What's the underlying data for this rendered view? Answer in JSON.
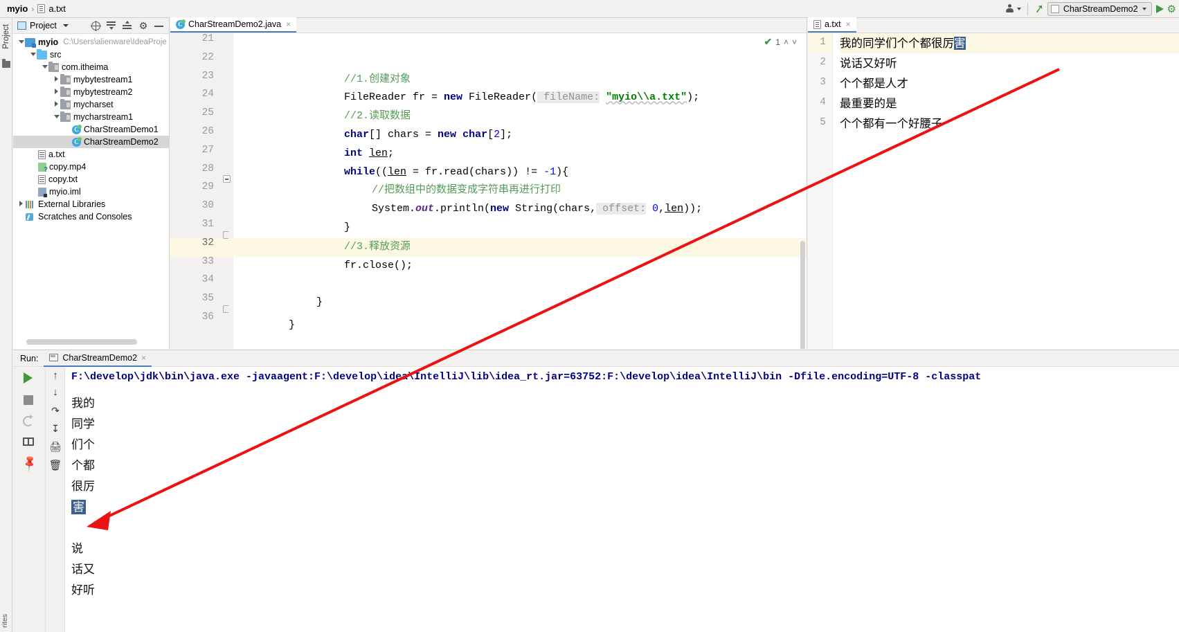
{
  "window": {
    "breadcrumb_root": "myio",
    "breadcrumb_sep": "›",
    "breadcrumb_file": "a.txt"
  },
  "toolbar": {
    "person_icon": "person-icon",
    "caret_icon": "chevron-down-icon",
    "hammer_icon": "hammer-icon",
    "run_config_name": "CharStreamDemo2",
    "run_config_caret": "∨",
    "run_button": "run-icon",
    "debug_button": "debug-icon"
  },
  "left_strip": {
    "project_tab": "Project",
    "favorites_tab": "rites"
  },
  "project_panel": {
    "title": "Project",
    "title_caret": "▾",
    "icons": [
      "locate-icon",
      "expand-all-icon",
      "collapse-all-icon",
      "gear-icon",
      "minimize-icon"
    ],
    "tree": [
      {
        "indent": 0,
        "arrow": "down",
        "icon": "module",
        "label": "myio",
        "bold": true,
        "path": "C:\\Users\\alienware\\IdeaProje",
        "selected": false
      },
      {
        "indent": 1,
        "arrow": "down",
        "icon": "folder-src",
        "label": "src",
        "bold": false,
        "path": "",
        "selected": false
      },
      {
        "indent": 2,
        "arrow": "down",
        "icon": "pkg",
        "label": "com.itheima",
        "bold": false,
        "path": "",
        "selected": false
      },
      {
        "indent": 3,
        "arrow": "right",
        "icon": "pkg",
        "label": "mybytestream1",
        "bold": false,
        "path": "",
        "selected": false
      },
      {
        "indent": 3,
        "arrow": "right",
        "icon": "pkg",
        "label": "mybytestream2",
        "bold": false,
        "path": "",
        "selected": false
      },
      {
        "indent": 3,
        "arrow": "right",
        "icon": "pkg",
        "label": "mycharset",
        "bold": false,
        "path": "",
        "selected": false
      },
      {
        "indent": 3,
        "arrow": "down",
        "icon": "pkg",
        "label": "mycharstream1",
        "bold": false,
        "path": "",
        "selected": false
      },
      {
        "indent": 4,
        "arrow": "none",
        "icon": "clz",
        "label": "CharStreamDemo1",
        "bold": false,
        "path": "",
        "selected": false
      },
      {
        "indent": 4,
        "arrow": "none",
        "icon": "clz",
        "label": "CharStreamDemo2",
        "bold": false,
        "path": "",
        "selected": true
      },
      {
        "indent": 1,
        "arrow": "none",
        "icon": "txt",
        "label": "a.txt",
        "bold": false,
        "path": "",
        "selected": false
      },
      {
        "indent": 1,
        "arrow": "none",
        "icon": "mp4",
        "label": "copy.mp4",
        "bold": false,
        "path": "",
        "selected": false
      },
      {
        "indent": 1,
        "arrow": "none",
        "icon": "txt",
        "label": "copy.txt",
        "bold": false,
        "path": "",
        "selected": false
      },
      {
        "indent": 1,
        "arrow": "none",
        "icon": "iml",
        "label": "myio.iml",
        "bold": false,
        "path": "",
        "selected": false
      },
      {
        "indent": 0,
        "arrow": "right",
        "icon": "extlib",
        "label": "External Libraries",
        "bold": false,
        "path": "",
        "selected": false
      },
      {
        "indent": 0,
        "arrow": "none",
        "icon": "scratch",
        "label": "Scratches and Consoles",
        "bold": false,
        "path": "",
        "selected": false
      }
    ]
  },
  "editor": {
    "tab_label": "CharStreamDemo2.java",
    "tab_close": "×",
    "inspection_count": "1",
    "inspection_check": "✔",
    "chevron_up": "˄",
    "chevron_down": "˅",
    "first_line_number": 21,
    "current_line": 32,
    "lines": [
      {
        "n": 21,
        "text": ""
      },
      {
        "n": 22,
        "text": ""
      },
      {
        "n": 23,
        "text": "//1.创建对象"
      },
      {
        "n": 24,
        "text": "FileReader fr = new FileReader( fileName: \"myio\\\\a.txt\");"
      },
      {
        "n": 25,
        "text": "//2.读取数据"
      },
      {
        "n": 26,
        "text": "char[] chars = new char[2];"
      },
      {
        "n": 27,
        "text": "int len;"
      },
      {
        "n": 28,
        "text": "while((len = fr.read(chars)) != -1){"
      },
      {
        "n": 29,
        "text": "//把数组中的数据变成字符串再进行打印"
      },
      {
        "n": 30,
        "text": "System.out.println(new String(chars, offset: 0,len));"
      },
      {
        "n": 31,
        "text": "}"
      },
      {
        "n": 32,
        "text": "//3.释放资源"
      },
      {
        "n": 33,
        "text": "fr.close();"
      },
      {
        "n": 34,
        "text": ""
      },
      {
        "n": 35,
        "text": "}"
      },
      {
        "n": 36,
        "text": "}"
      }
    ]
  },
  "right_panel": {
    "tab_label": "a.txt",
    "tab_close": "×",
    "file_icon": "text-file-icon",
    "lines": [
      {
        "n": 1,
        "text": "我的同学们个个都很厉",
        "selected_tail": "害"
      },
      {
        "n": 2,
        "text": "说话又好听",
        "selected_tail": ""
      },
      {
        "n": 3,
        "text": "个个都是人才",
        "selected_tail": ""
      },
      {
        "n": 4,
        "text": "最重要的是",
        "selected_tail": ""
      },
      {
        "n": 5,
        "text": "个个都有一个好腰子",
        "selected_tail": ""
      }
    ]
  },
  "run_panel": {
    "run_label": "Run:",
    "tab_label": "CharStreamDemo2",
    "tab_close": "×",
    "tools_left": [
      "run-icon",
      "stop-icon",
      "rerun-icon",
      "layout-icon",
      "pin-icon"
    ],
    "tools_right": [
      "scroll-up-icon",
      "scroll-down-icon",
      "soft-wrap-icon",
      "scroll-to-end-icon",
      "print-icon",
      "clear-all-icon"
    ],
    "command_line": "F:\\develop\\jdk\\bin\\java.exe -javaagent:F:\\develop\\idea\\IntelliJ\\lib\\idea_rt.jar=63752:F:\\develop\\idea\\IntelliJ\\bin -Dfile.encoding=UTF-8 -classpat",
    "output_lines": [
      {
        "text": "我的",
        "selected": false
      },
      {
        "text": "同学",
        "selected": false
      },
      {
        "text": "们个",
        "selected": false
      },
      {
        "text": "个都",
        "selected": false
      },
      {
        "text": "很厉",
        "selected": false
      },
      {
        "text": "害",
        "selected": true
      },
      {
        "text": "",
        "selected": false
      },
      {
        "text": "说",
        "selected": false
      },
      {
        "text": "话又",
        "selected": false
      },
      {
        "text": "好听",
        "selected": false
      }
    ]
  },
  "annotation": {
    "arrow_color": "#ee1111",
    "description": "red-arrow-annotation"
  },
  "colors": {
    "accent_blue": "#4d7fbf",
    "keyword": "#000080",
    "comment": "#559b55",
    "string": "#008000",
    "number": "#0000ee",
    "selection": "#3a5f93",
    "current_line": "#fdf8e3",
    "green_run": "#3c9a3c"
  }
}
